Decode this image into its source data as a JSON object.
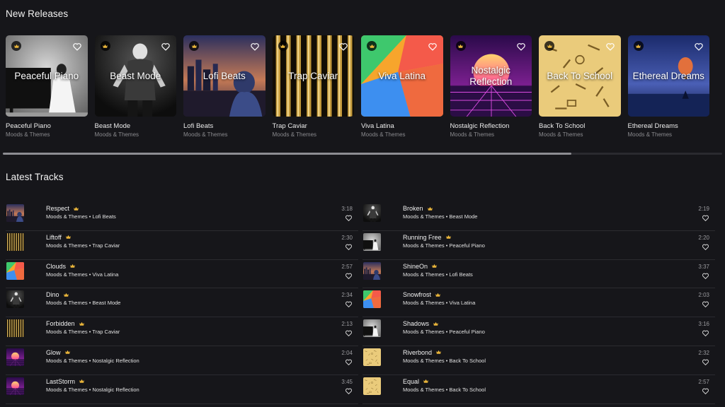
{
  "sections": {
    "new_releases": "New Releases",
    "latest_tracks": "Latest Tracks"
  },
  "colors": {
    "accent_gold": "#e8b43a",
    "background": "#16161a",
    "divider": "#2b2b30"
  },
  "icons": {
    "premium": "crown-icon",
    "favorite": "heart-outline-icon"
  },
  "playlists": [
    {
      "title": "Peaceful Piano",
      "subtitle": "Moods & Themes",
      "cover": "piano-bw",
      "overlay": "Peaceful Piano"
    },
    {
      "title": "Beast Mode",
      "subtitle": "Moods & Themes",
      "cover": "beast-bw",
      "overlay": "Beast Mode"
    },
    {
      "title": "Lofi Beats",
      "subtitle": "Moods & Themes",
      "cover": "lofi-city",
      "overlay": "Lofi Beats"
    },
    {
      "title": "Trap Caviar",
      "subtitle": "Moods & Themes",
      "cover": "gold-bars",
      "overlay": "Trap Caviar"
    },
    {
      "title": "Viva Latina",
      "subtitle": "Moods & Themes",
      "cover": "color-blocks",
      "overlay": "Viva Latina"
    },
    {
      "title": "Nostalgic Reflection",
      "subtitle": "Moods & Themes",
      "cover": "synthwave",
      "overlay": "Nostalgic\nReflection"
    },
    {
      "title": "Back To School",
      "subtitle": "Moods & Themes",
      "cover": "school-doodles",
      "overlay": "Back To School"
    },
    {
      "title": "Ethereal Dreams",
      "subtitle": "Moods & Themes",
      "cover": "balloon-sea",
      "overlay": "Ethereal Dreams"
    }
  ],
  "scroll_position": 0.79,
  "tracks_left": [
    {
      "name": "Respect",
      "meta": "Moods & Themes • Lofi Beats",
      "duration": "3:18",
      "cover": "lofi-city"
    },
    {
      "name": "Liftoff",
      "meta": "Moods & Themes • Trap Caviar",
      "duration": "2:30",
      "cover": "gold-bars"
    },
    {
      "name": "Clouds",
      "meta": "Moods & Themes • Viva Latina",
      "duration": "2:57",
      "cover": "color-blocks"
    },
    {
      "name": "Dino",
      "meta": "Moods & Themes • Beast Mode",
      "duration": "2:34",
      "cover": "beast-bw"
    },
    {
      "name": "Forbidden",
      "meta": "Moods & Themes • Trap Caviar",
      "duration": "2:13",
      "cover": "gold-bars"
    },
    {
      "name": "Glow",
      "meta": "Moods & Themes • Nostalgic Reflection",
      "duration": "2:04",
      "cover": "synthwave"
    },
    {
      "name": "LastStorm",
      "meta": "Moods & Themes • Nostalgic Reflection",
      "duration": "3:45",
      "cover": "synthwave"
    }
  ],
  "tracks_right": [
    {
      "name": "Broken",
      "meta": "Moods & Themes • Beast Mode",
      "duration": "2:19",
      "cover": "beast-bw"
    },
    {
      "name": "Running Free",
      "meta": "Moods & Themes • Peaceful Piano",
      "duration": "2:20",
      "cover": "piano-bw"
    },
    {
      "name": "ShineOn",
      "meta": "Moods & Themes • Lofi Beats",
      "duration": "3:37",
      "cover": "lofi-city"
    },
    {
      "name": "Snowfrost",
      "meta": "Moods & Themes • Viva Latina",
      "duration": "2:03",
      "cover": "color-blocks"
    },
    {
      "name": "Shadows",
      "meta": "Moods & Themes • Peaceful Piano",
      "duration": "3:16",
      "cover": "piano-bw"
    },
    {
      "name": "Riverbond",
      "meta": "Moods & Themes • Back To School",
      "duration": "2:32",
      "cover": "school-doodles"
    },
    {
      "name": "Equal",
      "meta": "Moods & Themes • Back To School",
      "duration": "2:57",
      "cover": "school-doodles"
    }
  ]
}
